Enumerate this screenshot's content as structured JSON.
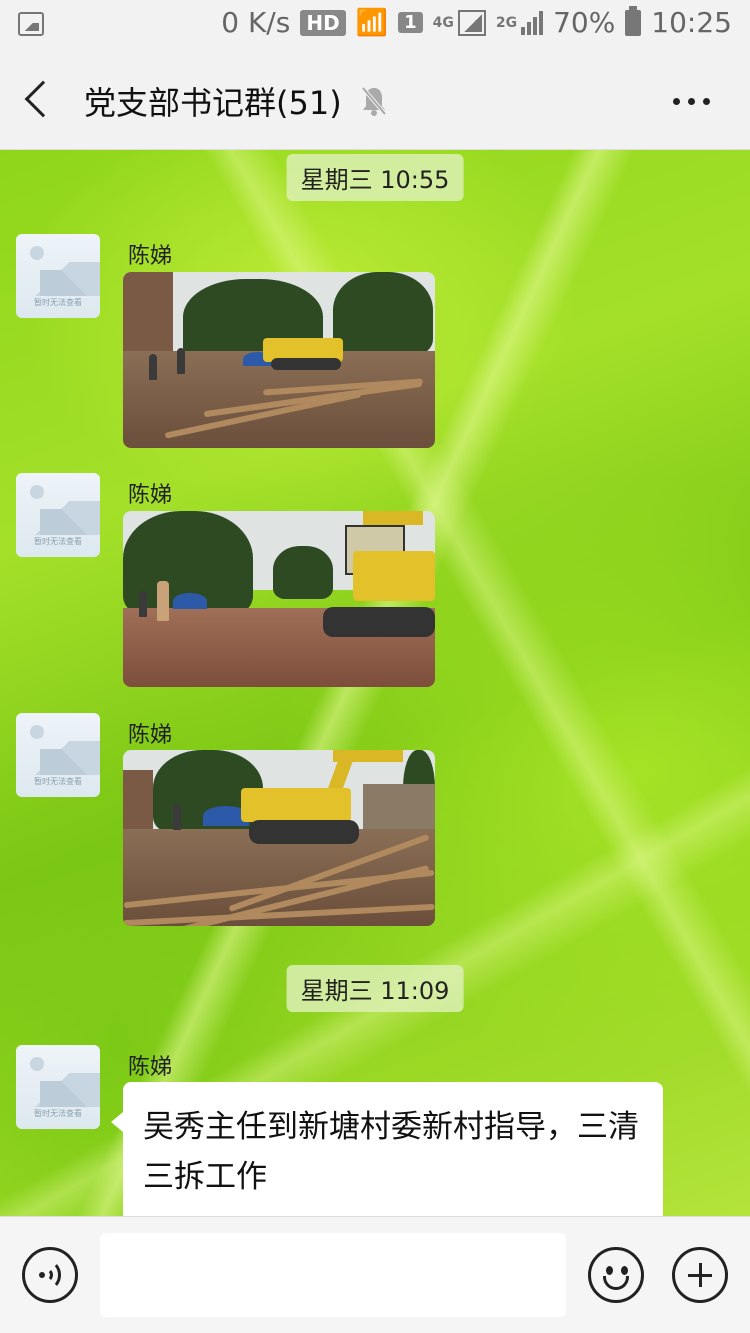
{
  "status_bar": {
    "speed": "0 K/s",
    "hd": "HD",
    "sim": "1",
    "net_4g": "4G",
    "net_2g": "2G",
    "battery": "70%",
    "time": "10:25"
  },
  "header": {
    "title": "党支部书记群(51)"
  },
  "chat": {
    "time_tags": [
      "星期三 10:55",
      "星期三 11:09"
    ],
    "avatar_caption": "暂时无法查看",
    "messages": [
      {
        "sender": "陈娣",
        "type": "image"
      },
      {
        "sender": "陈娣",
        "type": "image"
      },
      {
        "sender": "陈娣",
        "type": "image"
      },
      {
        "sender": "陈娣",
        "type": "text",
        "text": "吴秀主任到新塘村委新村指导，三清三拆工作"
      }
    ]
  },
  "input_bar": {
    "placeholder": ""
  },
  "icons": {
    "back": "back-arrow-icon",
    "mute": "bell-muted-icon",
    "more": "more-dots-icon",
    "voice": "voice-icon",
    "emoji": "emoji-icon",
    "plus": "plus-icon"
  },
  "colors": {
    "bubble": "#ffffff",
    "header_bg": "#f2f2f2",
    "wallpaper": "#8fd61a"
  }
}
